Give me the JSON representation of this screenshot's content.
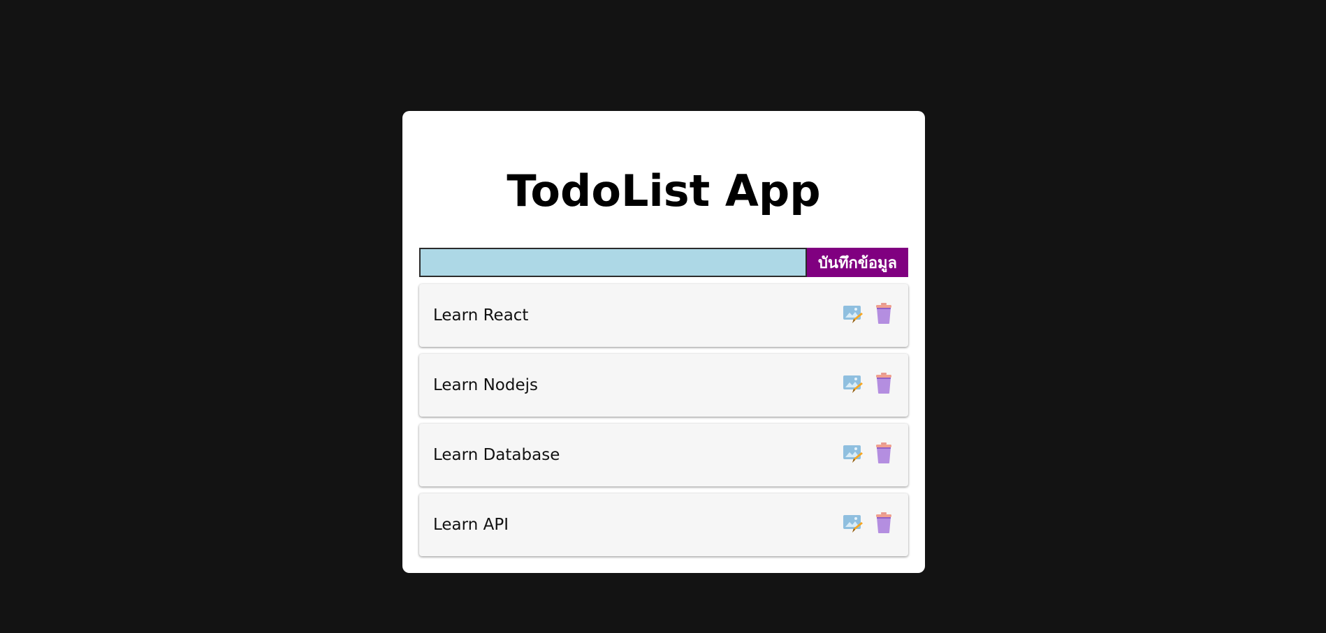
{
  "app": {
    "title": "TodoList App"
  },
  "form": {
    "input_value": "",
    "input_placeholder": "",
    "save_label": "บันทึกข้อมูล"
  },
  "todos": [
    {
      "text": "Learn React",
      "edit_icon": "edit-image-icon",
      "delete_icon": "trash-icon"
    },
    {
      "text": "Learn Nodejs",
      "edit_icon": "edit-image-icon",
      "delete_icon": "trash-icon"
    },
    {
      "text": "Learn Database",
      "edit_icon": "edit-image-icon",
      "delete_icon": "trash-icon"
    },
    {
      "text": "Learn API",
      "edit_icon": "edit-image-icon",
      "delete_icon": "trash-icon"
    }
  ],
  "colors": {
    "page_background": "#131313",
    "card_background": "#ffffff",
    "input_background": "#add8e6",
    "save_button_background": "#800080",
    "item_background": "#f6f6f6",
    "trash_icon": "#b48ee0"
  }
}
